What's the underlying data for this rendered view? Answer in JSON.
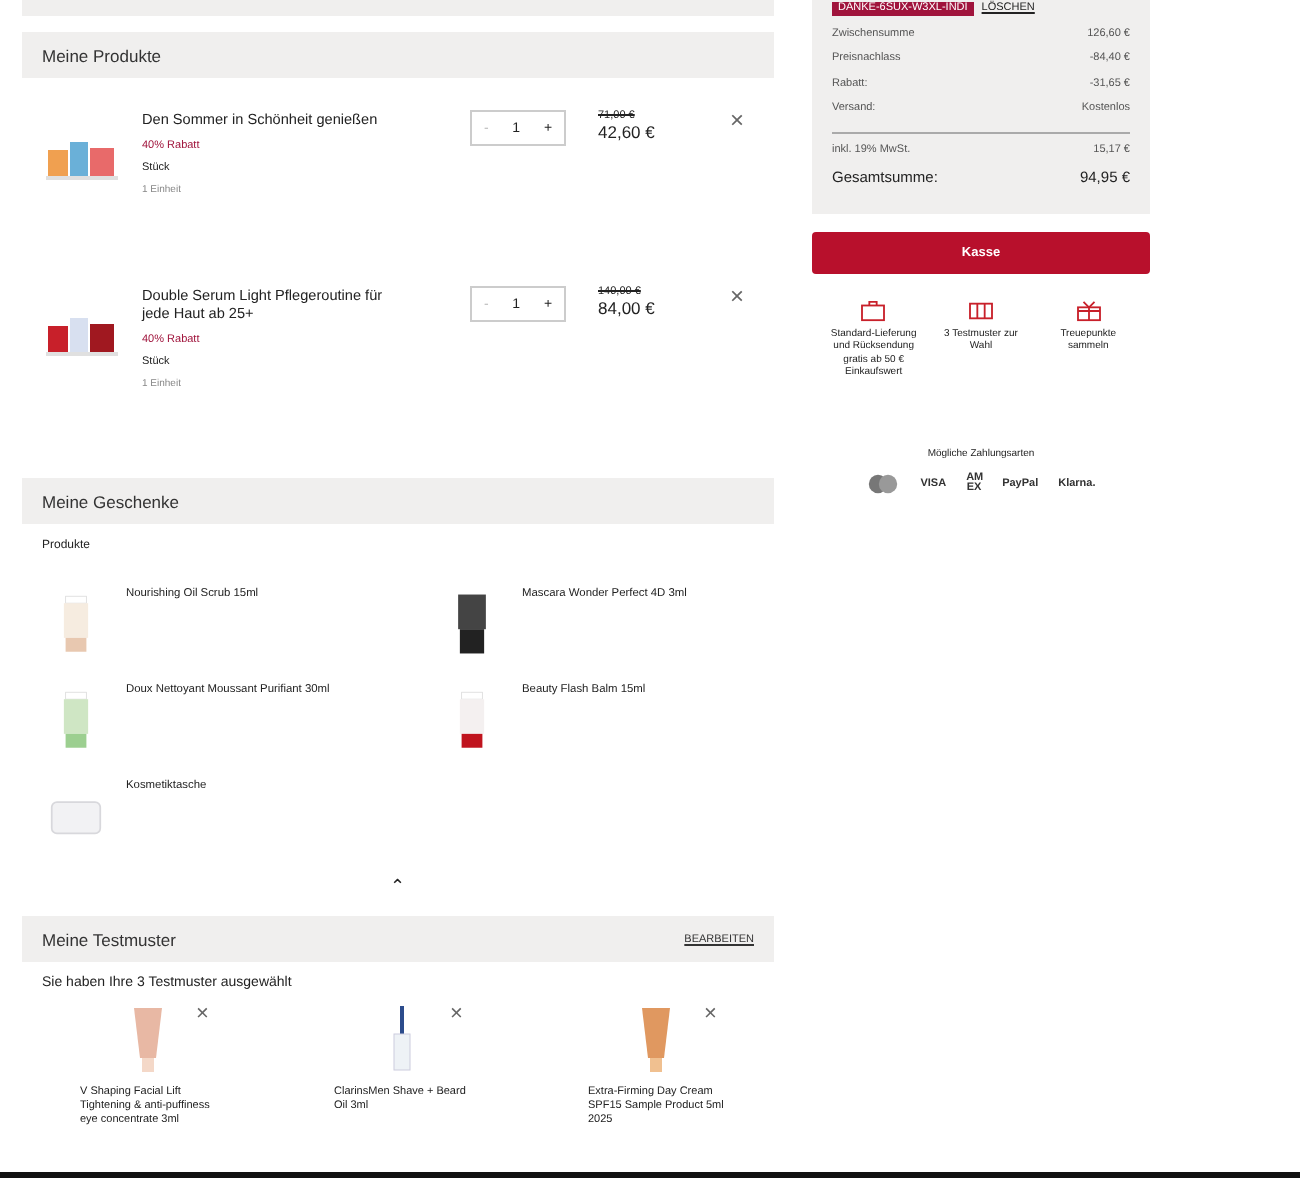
{
  "products": {
    "title": "Meine Produkte",
    "items": [
      {
        "name": "Den Sommer in Schönheit genießen",
        "discount": "40% Rabatt",
        "unit": "Stück",
        "amount": "1 Einheit",
        "quantity": "1",
        "minus": "-",
        "plus": "+",
        "old_price": "71,00 €",
        "price": "42,60 €",
        "remove": "×",
        "kind": "set-colorful"
      },
      {
        "name": "Double Serum Light Pflegeroutine für jede Haut ab 25+",
        "discount": "40% Rabatt",
        "unit": "Stück",
        "amount": "1 Einheit",
        "quantity": "1",
        "minus": "-",
        "plus": "+",
        "old_price": "140,00 €",
        "price": "84,00 €",
        "remove": "×",
        "kind": "set-red"
      }
    ]
  },
  "gifts": {
    "title": "Meine Geschenke",
    "subtitle": "Produkte",
    "items": [
      {
        "name": "Nourishing Oil Scrub 15ml",
        "kind": "tube-cream"
      },
      {
        "name": "Mascara Wonder Perfect 4D 3ml",
        "kind": "mascara"
      },
      {
        "name": "Doux Nettoyant Moussant Purifiant 30ml",
        "kind": "tube-green"
      },
      {
        "name": "Beauty Flash Balm 15ml",
        "kind": "tube-red"
      },
      {
        "name": "Kosmetiktasche",
        "kind": "pouch"
      }
    ],
    "collapse": "⌃"
  },
  "samples": {
    "title": "Meine Testmuster",
    "edit": "BEARBEITEN",
    "message": "Sie haben Ihre 3 Testmuster ausgewählt",
    "items": [
      {
        "name": "V Shaping Facial Lift Tightening & anti-puffiness eye concentrate 3ml",
        "remove": "×",
        "kind": "tube-pink"
      },
      {
        "name": "ClarinsMen Shave + Beard Oil 3ml",
        "remove": "×",
        "kind": "dropper"
      },
      {
        "name": "Extra-Firming Day Cream SPF15 Sample Product 5ml 2025",
        "remove": "×",
        "kind": "tube-orange"
      }
    ]
  },
  "summary": {
    "coupon": "DANKE-6SUX-W3XL-INDI",
    "coupon_remove": "LÖSCHEN",
    "rows": [
      {
        "label": "Zwischensumme",
        "value": "126,60 €"
      },
      {
        "label": "Preisnachlass",
        "value": "-84,40 €"
      },
      {
        "label": "Rabatt:",
        "value": "-31,65 €"
      },
      {
        "label": "Versand:",
        "value": "Kostenlos"
      }
    ],
    "tax_label": "inkl. 19% MwSt.",
    "tax_value": "15,17 €",
    "total_label": "Gesamtsumme:",
    "total_value": "94,95 €",
    "checkout": "Kasse",
    "benefits": [
      {
        "text": "Standard-Lieferung und Rücksendung gratis ab 50 € Einkaufswert",
        "kind": "bag"
      },
      {
        "text": "3 Testmuster zur Wahl",
        "kind": "samples"
      },
      {
        "text": "Treuepunkte sammeln",
        "kind": "gift"
      }
    ],
    "payment_title": "Mögliche Zahlungsarten",
    "payments": [
      {
        "kind": "mastercard"
      },
      {
        "label": "VISA",
        "kind": "text"
      },
      {
        "label": "AM EX",
        "kind": "amex"
      },
      {
        "label": "PayPal",
        "kind": "paypal"
      },
      {
        "label": "Klarna.",
        "kind": "text"
      }
    ]
  }
}
